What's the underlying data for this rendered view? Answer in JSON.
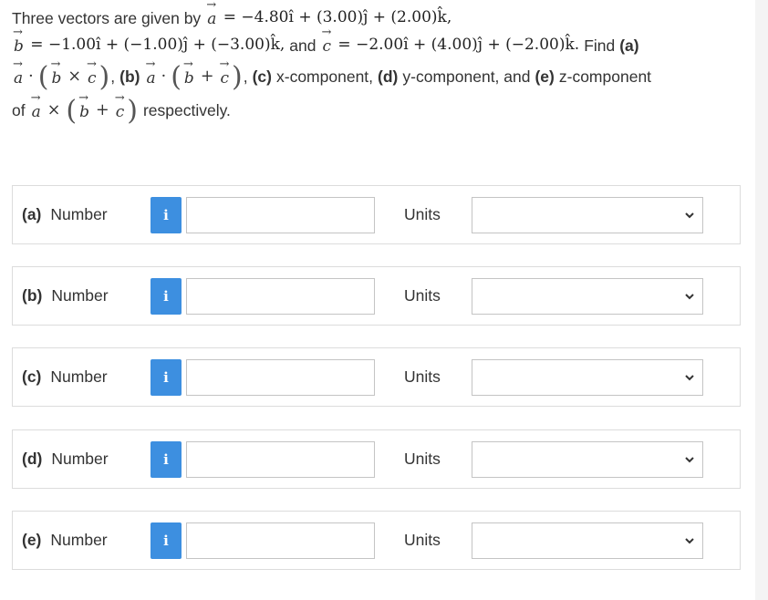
{
  "question": {
    "intro": "Three vectors are given by",
    "vec_a": "a",
    "vec_b": "b",
    "vec_c": "c",
    "eq": " = ",
    "a_expr": "−4.80î + (3.00)ĵ + (2.00)k̂,",
    "b_expr": "−1.00î + (−1.00)ĵ + (−3.00)k̂,",
    "and_text": "and",
    "c_expr": "−2.00î + (4.00)ĵ + (−2.00)k̂.",
    "find_text": "Find",
    "part_a": "(a)",
    "part_b": "(b)",
    "part_c": "(c)",
    "part_d": "(d)",
    "part_e": "(e)",
    "comma": ",",
    "c_text": "x-component,",
    "d_text": "y-component, and",
    "e_text": "z-component",
    "of_text": "of",
    "respectively": "respectively."
  },
  "answers": [
    {
      "part": "(a)",
      "label": "Number",
      "info_icon": "i",
      "value": "",
      "units_label": "Units",
      "units_value": ""
    },
    {
      "part": "(b)",
      "label": "Number",
      "info_icon": "i",
      "value": "",
      "units_label": "Units",
      "units_value": ""
    },
    {
      "part": "(c)",
      "label": "Number",
      "info_icon": "i",
      "value": "",
      "units_label": "Units",
      "units_value": ""
    },
    {
      "part": "(d)",
      "label": "Number",
      "info_icon": "i",
      "value": "",
      "units_label": "Units",
      "units_value": ""
    },
    {
      "part": "(e)",
      "label": "Number",
      "info_icon": "i",
      "value": "",
      "units_label": "Units",
      "units_value": ""
    }
  ],
  "colors": {
    "info_button": "#3d8fe0",
    "text": "#333333",
    "border": "#dcdcdc"
  }
}
